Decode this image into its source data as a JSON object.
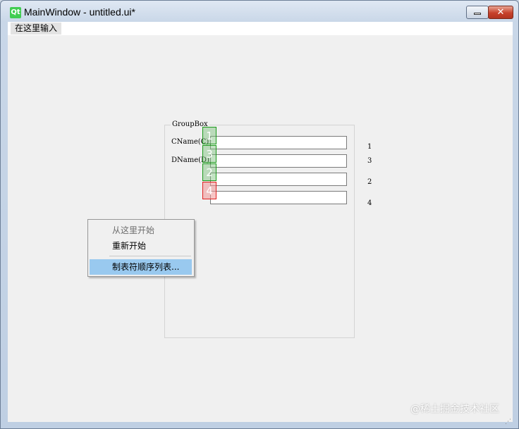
{
  "window": {
    "title": "MainWindow - untitled.ui*",
    "logo_text": "Qt",
    "close_glyph": "✕"
  },
  "menubar": {
    "entry": "在这里输入"
  },
  "groupbox": {
    "title": "GroupBox",
    "labels": [
      "CName(C)",
      "DName(D)"
    ]
  },
  "tab_order": {
    "markers": [
      "1",
      "3",
      "2",
      "4"
    ],
    "side_numbers": [
      "1",
      "3",
      "2",
      "4"
    ],
    "marker_color": "#1a9a1a",
    "active_marker_color": "#e02020"
  },
  "context_menu": {
    "items": [
      {
        "label": "从这里开始",
        "enabled": false
      },
      {
        "label": "重新开始",
        "enabled": true
      },
      {
        "label": "制表符顺序列表...",
        "enabled": true,
        "highlighted": true
      }
    ],
    "highlight_color": "#99c9ef"
  },
  "watermark": "@稀土掘金技术社区"
}
